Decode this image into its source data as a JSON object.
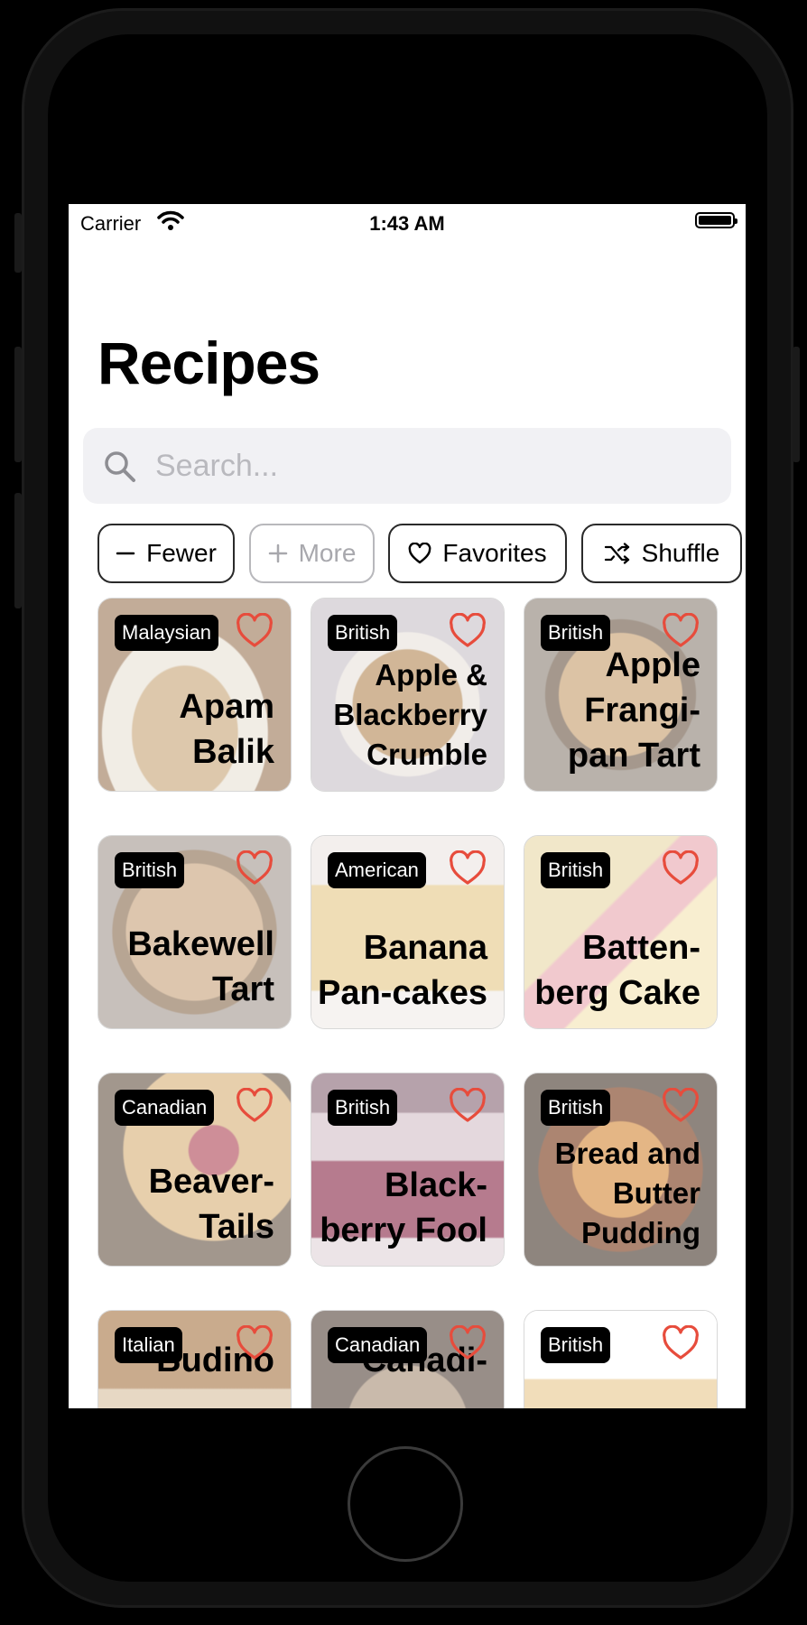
{
  "status_bar": {
    "carrier": "Carrier",
    "time": "1:43 AM"
  },
  "title": "Recipes",
  "search": {
    "placeholder": "Search...",
    "value": ""
  },
  "chips": [
    {
      "label": "Fewer",
      "icon": "minus-icon",
      "enabled": true
    },
    {
      "label": "More",
      "icon": "plus-icon",
      "enabled": false
    },
    {
      "label": "Favorites",
      "icon": "heart-icon",
      "enabled": true
    },
    {
      "label": "Shuffle",
      "icon": "shuffle-icon",
      "enabled": true
    }
  ],
  "recipes": [
    {
      "name": "Apam Balik",
      "cuisine": "Malaysian",
      "favorite": false
    },
    {
      "name": "Apple & Blackberry Crumble",
      "cuisine": "British",
      "favorite": false
    },
    {
      "name": "Apple Frangi-pan Tart",
      "cuisine": "British",
      "favorite": false
    },
    {
      "name": "Bakewell Tart",
      "cuisine": "British",
      "favorite": false
    },
    {
      "name": "Banana Pan-cakes",
      "cuisine": "American",
      "favorite": false
    },
    {
      "name": "Batten-berg Cake",
      "cuisine": "British",
      "favorite": false
    },
    {
      "name": "Beaver-Tails",
      "cuisine": "Canadian",
      "favorite": false
    },
    {
      "name": "Black-berry Fool",
      "cuisine": "British",
      "favorite": false
    },
    {
      "name": "Bread and Butter Pudding",
      "cuisine": "British",
      "favorite": false
    },
    {
      "name": "Budino",
      "cuisine": "Italian",
      "favorite": false
    },
    {
      "name": "Canadi-",
      "cuisine": "Canadian",
      "favorite": false
    },
    {
      "name": "",
      "cuisine": "British",
      "favorite": false
    }
  ],
  "colors": {
    "heart": "#e74c3c",
    "tag_bg": "#000000",
    "search_bg": "#f1f1f4"
  }
}
